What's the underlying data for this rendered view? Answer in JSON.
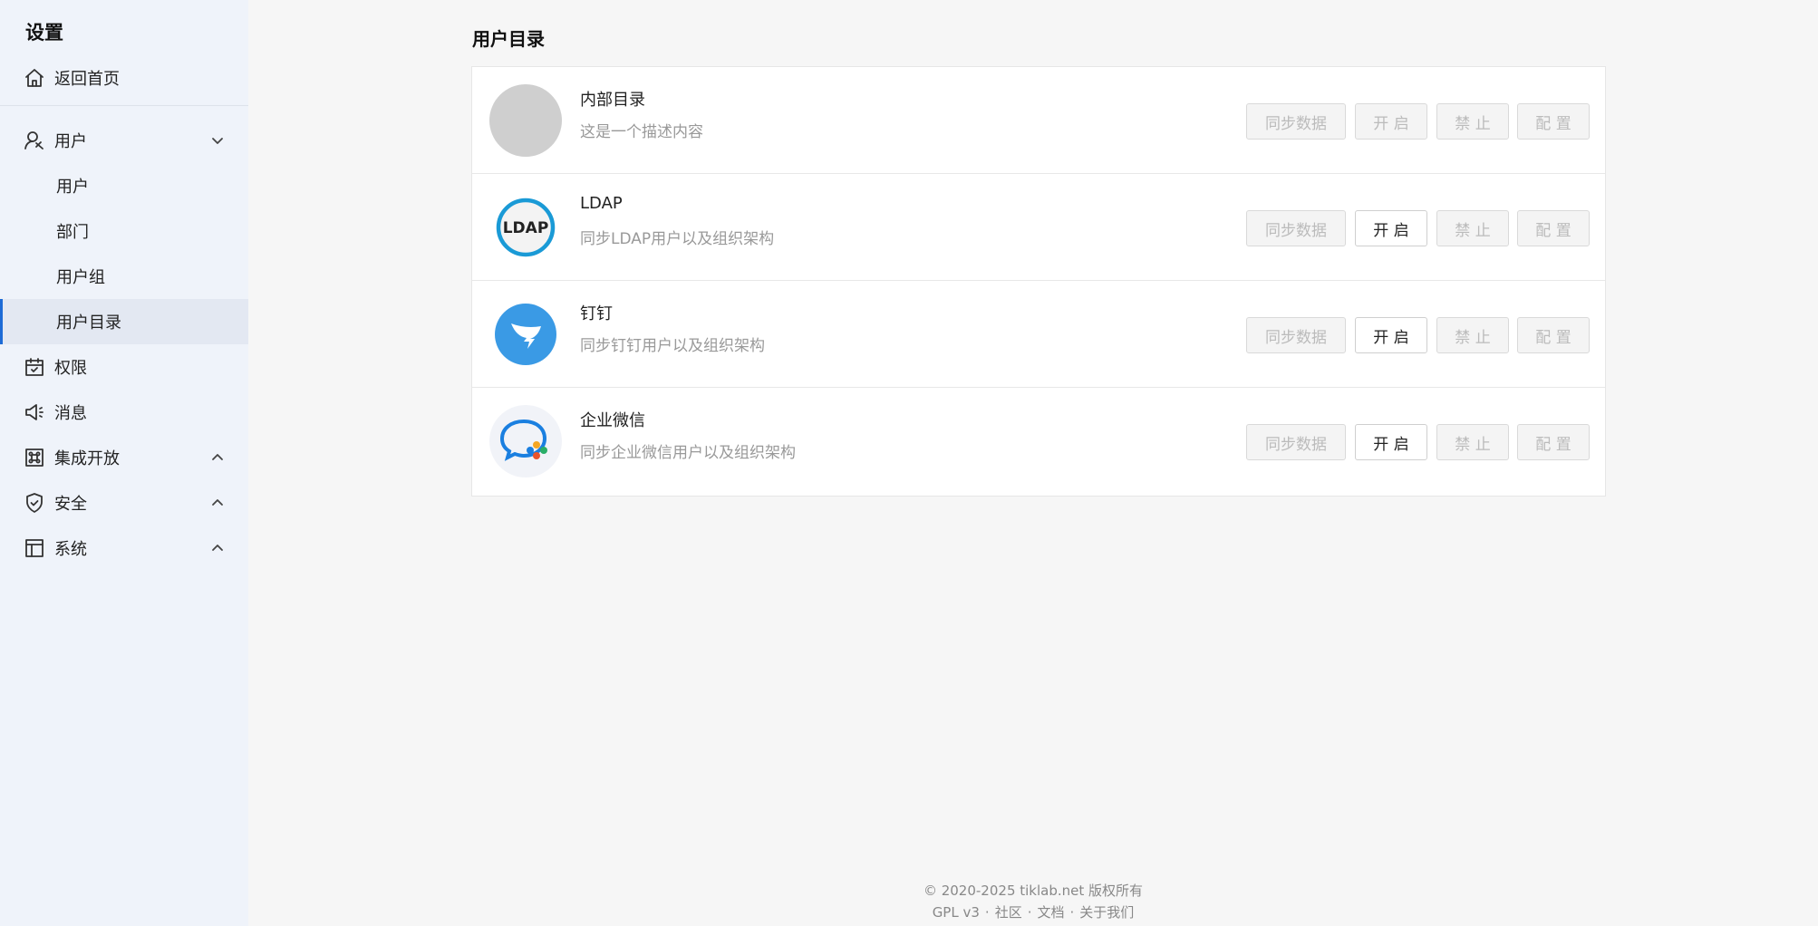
{
  "sidebar": {
    "title": "设置",
    "home": "返回首页",
    "user_group": "用户",
    "sub_items": [
      "用户",
      "部门",
      "用户组",
      "用户目录"
    ],
    "items": [
      {
        "label": "权限",
        "icon": "calendar-check-icon"
      },
      {
        "label": "消息",
        "icon": "megaphone-icon"
      },
      {
        "label": "集成开放",
        "icon": "command-icon"
      },
      {
        "label": "安全",
        "icon": "shield-icon"
      },
      {
        "label": "系统",
        "icon": "layout-icon"
      }
    ]
  },
  "main": {
    "title": "用户目录",
    "directories": [
      {
        "name": "内部目录",
        "desc": "这是一个描述内容",
        "logo": "gray-circle"
      },
      {
        "name": "LDAP",
        "desc": "同步LDAP用户以及组织架构",
        "logo": "ldap-logo",
        "logo_text": "LDAP"
      },
      {
        "name": "钉钉",
        "desc": "同步钉钉用户以及组织架构",
        "logo": "dingtalk-logo"
      },
      {
        "name": "企业微信",
        "desc": "同步企业微信用户以及组织架构",
        "logo": "wecom-logo"
      }
    ],
    "buttons": {
      "sync": "同步数据",
      "open": "开 启",
      "disable": "禁 止",
      "config": "配 置"
    }
  },
  "footer": {
    "copyright": "© 2020-2025 tiklab.net 版权所有",
    "links": [
      "GPL v3",
      "社区",
      "文档",
      "关于我们"
    ]
  },
  "colors": {
    "accent": "#1d6bd6",
    "dingtalk": "#3a9ae5",
    "ldap": "#1a9ad6"
  }
}
